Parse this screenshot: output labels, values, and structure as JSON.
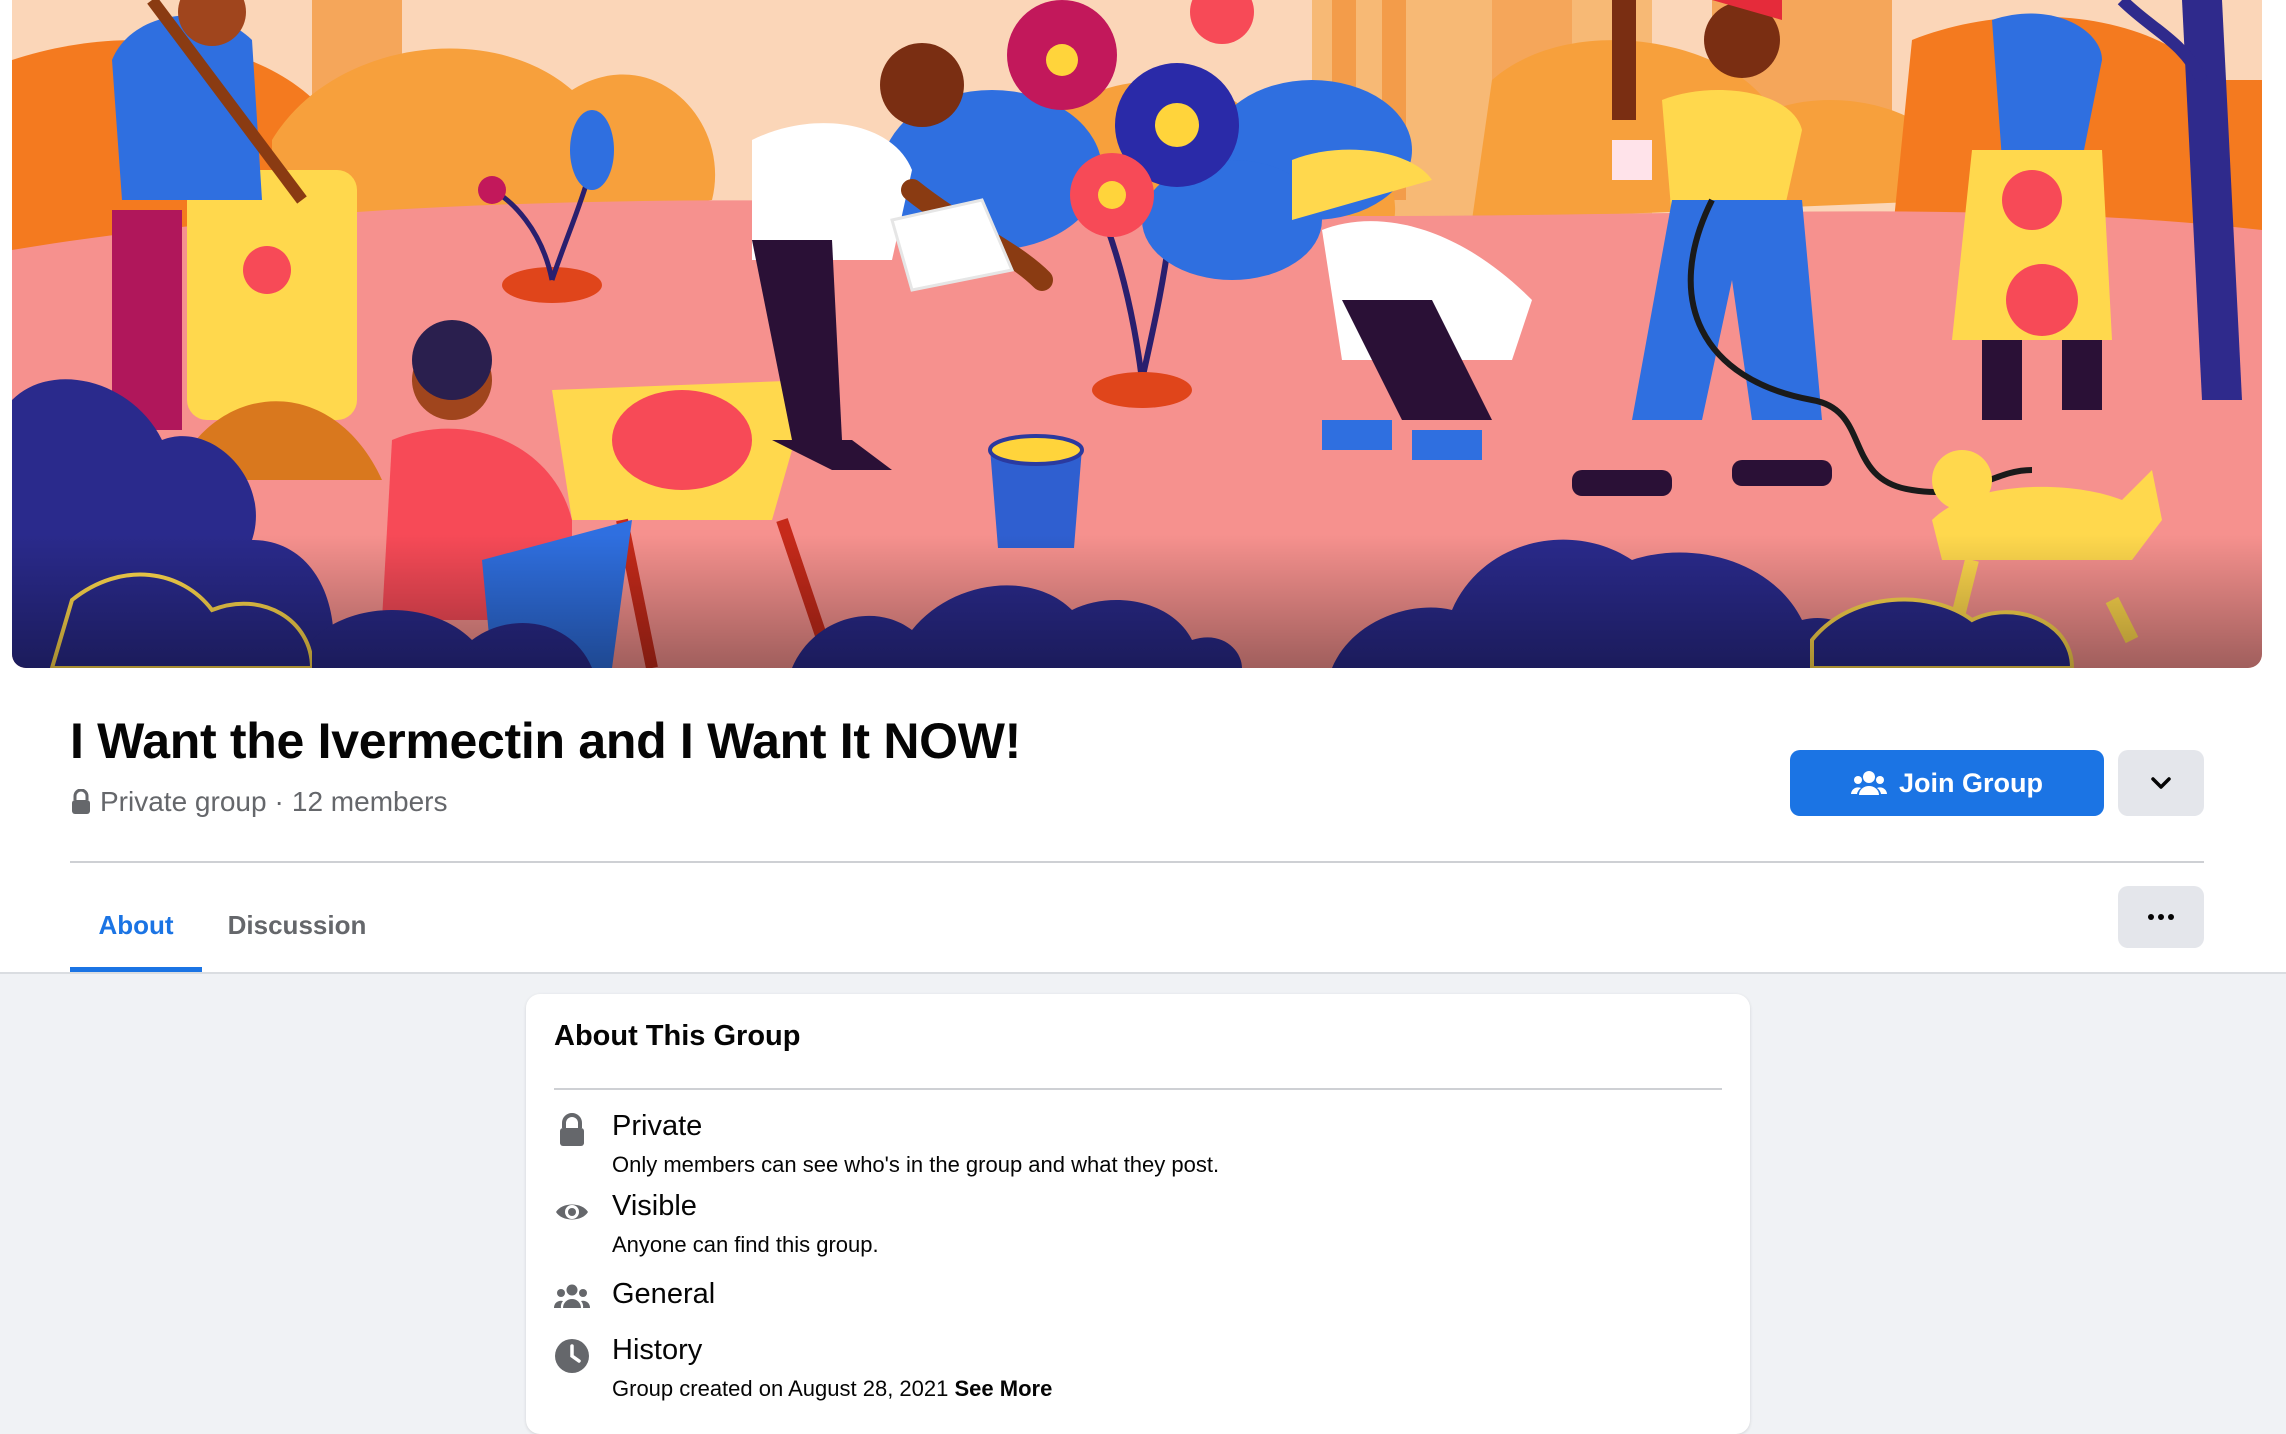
{
  "group": {
    "title": "I Want the Ivermectin and I Want It NOW!",
    "privacy": "Private group",
    "separator": "·",
    "members": "12 members"
  },
  "actions": {
    "join_label": "Join Group",
    "join_icon": "people-icon",
    "dropdown_icon": "chevron-down-icon",
    "more_icon": "more-dots-icon"
  },
  "tabs": [
    {
      "label": "About",
      "active": true
    },
    {
      "label": "Discussion",
      "active": false
    }
  ],
  "about": {
    "heading": "About This Group",
    "rows": [
      {
        "icon": "lock-icon",
        "title": "Private",
        "desc": "Only members can see who's in the group and what they post."
      },
      {
        "icon": "eye-icon",
        "title": "Visible",
        "desc": "Anyone can find this group."
      },
      {
        "icon": "people-icon",
        "title": "General",
        "desc": ""
      },
      {
        "icon": "clock-icon",
        "title": "History",
        "desc": "Group created on August 28, 2021",
        "link": "See More"
      }
    ]
  },
  "colors": {
    "accent": "#1b74e4",
    "secondary_text": "#65676b",
    "page_background": "#f0f2f5",
    "button_gray": "#e4e6eb"
  }
}
